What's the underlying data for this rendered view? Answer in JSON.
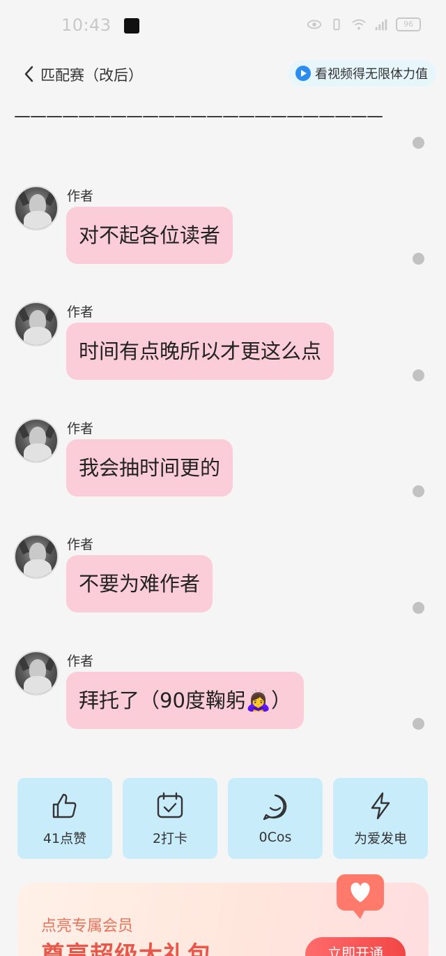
{
  "status_bar": {
    "time": "10:43",
    "battery": "96"
  },
  "nav": {
    "title": "匹配赛（改后）",
    "promo_text": "看视频得无限体力值"
  },
  "divider_text": "———————————————————————",
  "messages": [
    {
      "author": "作者",
      "text": "对不起各位读者"
    },
    {
      "author": "作者",
      "text": "时间有点晚所以才更这么点"
    },
    {
      "author": "作者",
      "text": "我会抽时间更的"
    },
    {
      "author": "作者",
      "text": "不要为难作者"
    },
    {
      "author": "作者",
      "text": "拜托了（90度鞠躬🙇‍♀️）"
    }
  ],
  "actions": [
    {
      "label": "41点赞",
      "icon": "thumbs-up-icon"
    },
    {
      "label": "2打卡",
      "icon": "calendar-check-icon"
    },
    {
      "label": "0Cos",
      "icon": "chat-bubble-icon"
    },
    {
      "label": "为爱发电",
      "icon": "lightning-icon"
    }
  ],
  "vip": {
    "subtitle": "点亮专属会员",
    "title": "尊享超级大礼包",
    "button": "立即开通"
  },
  "colors": {
    "bubble": "#fbcdd8",
    "action_card": "#c9ecfb",
    "vip_accent": "#e8584a"
  }
}
